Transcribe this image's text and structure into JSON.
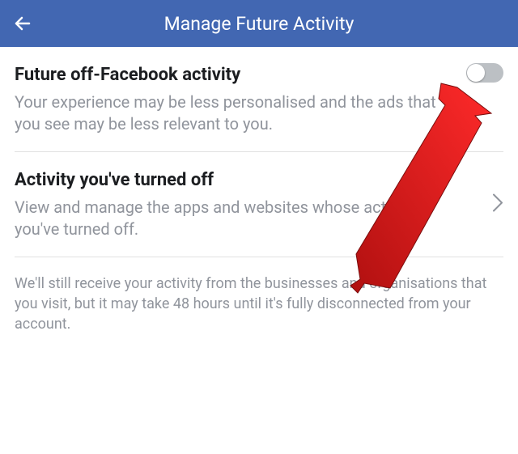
{
  "header": {
    "title": "Manage Future Activity"
  },
  "sections": {
    "future_activity": {
      "title": "Future off-Facebook activity",
      "description": "Your experience may be less personalised and the ads that you see may be less relevant to you."
    },
    "turned_off": {
      "title": "Activity you've turned off",
      "description": "View and manage the apps and websites whose activity you've turned off."
    }
  },
  "footer": {
    "text": "We'll still receive your activity from the businesses and organisations that you visit, but it may take 48 hours until it's fully disconnected from your account."
  }
}
